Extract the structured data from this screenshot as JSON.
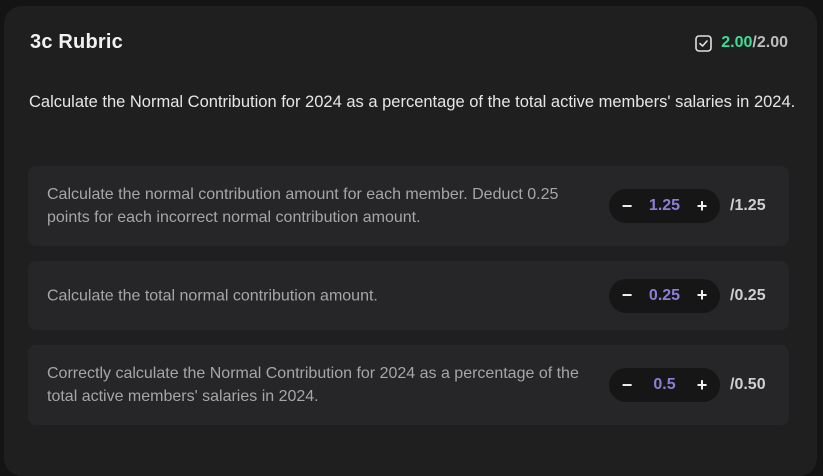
{
  "rubric": {
    "title": "3c Rubric",
    "score_earned": "2.00",
    "score_max": "/2.00",
    "question": "Calculate the Normal Contribution for 2024 as a percentage of the total active members' salaries in 2024.",
    "criteria": [
      {
        "text": "Calculate the normal contribution amount for each member. Deduct 0.25 points for each incorrect normal contribution amount.",
        "value": "1.25",
        "max": "/1.25",
        "minus": "−",
        "plus": "+"
      },
      {
        "text": "Calculate the total normal contribution amount.",
        "value": "0.25",
        "max": "/0.25",
        "minus": "−",
        "plus": "+"
      },
      {
        "text": "Correctly calculate the Normal Contribution for 2024 as a percentage of the total active members' salaries in 2024.",
        "value": "0.5",
        "max": "/0.50",
        "minus": "−",
        "plus": "+"
      }
    ]
  },
  "colors": {
    "earned": "#3ddc97",
    "step_value": "#8b7fd4"
  },
  "icons": {
    "score": "checkbox-check-icon",
    "decrement": "minus-icon",
    "increment": "plus-icon"
  }
}
